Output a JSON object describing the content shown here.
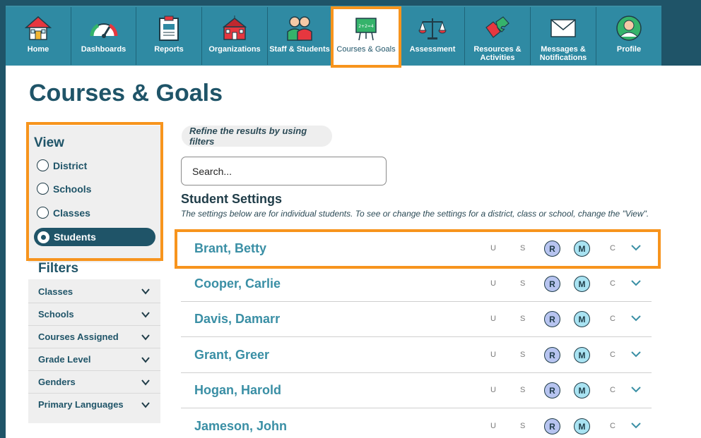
{
  "nav": [
    {
      "label": "Home",
      "icon": "home-icon"
    },
    {
      "label": "Dashboards",
      "icon": "gauge-icon"
    },
    {
      "label": "Reports",
      "icon": "clipboard-icon"
    },
    {
      "label": "Organizations",
      "icon": "school-building-icon"
    },
    {
      "label": "Staff & Students",
      "icon": "people-icon"
    },
    {
      "label": "Courses & Goals",
      "icon": "chalkboard-icon",
      "active": true
    },
    {
      "label": "Assessment",
      "icon": "scale-icon"
    },
    {
      "label": "Resources & Activities",
      "icon": "puzzle-icon"
    },
    {
      "label": "Messages & Notifications",
      "icon": "envelope-icon"
    },
    {
      "label": "Profile",
      "icon": "user-icon"
    }
  ],
  "page": {
    "title": "Courses & Goals"
  },
  "view": {
    "title": "View",
    "options": [
      {
        "label": "District",
        "selected": false
      },
      {
        "label": "Schools",
        "selected": false
      },
      {
        "label": "Classes",
        "selected": false
      },
      {
        "label": "Students",
        "selected": true
      }
    ]
  },
  "filters": {
    "title": "Filters",
    "items": [
      "Classes",
      "Schools",
      "Courses Assigned",
      "Grade Level",
      "Genders",
      "Primary Languages"
    ]
  },
  "content": {
    "refine_label": "Refine the results by using filters",
    "search_placeholder": "Search...",
    "settings_title": "Student Settings",
    "settings_desc": "The settings below are for individual students. To see or change the settings for a district, class or school, change the \"View\"."
  },
  "students": [
    {
      "name": "Brant, Betty",
      "u": "U",
      "s": "S",
      "r": "R",
      "m": "M",
      "c": "C"
    },
    {
      "name": "Cooper, Carlie",
      "u": "U",
      "s": "S",
      "r": "R",
      "m": "M",
      "c": "C"
    },
    {
      "name": "Davis, Damarr",
      "u": "U",
      "s": "S",
      "r": "R",
      "m": "M",
      "c": "C"
    },
    {
      "name": "Grant, Greer",
      "u": "U",
      "s": "S",
      "r": "R",
      "m": "M",
      "c": "C"
    },
    {
      "name": "Hogan, Harold",
      "u": "U",
      "s": "S",
      "r": "R",
      "m": "M",
      "c": "C"
    },
    {
      "name": "Jameson, John",
      "u": "U",
      "s": "S",
      "r": "R",
      "m": "M",
      "c": "C"
    }
  ],
  "colors": {
    "highlight": "#f7941d",
    "nav": "#2f8aa3",
    "brand_dark": "#1f5468",
    "link": "#3a8fa5"
  }
}
